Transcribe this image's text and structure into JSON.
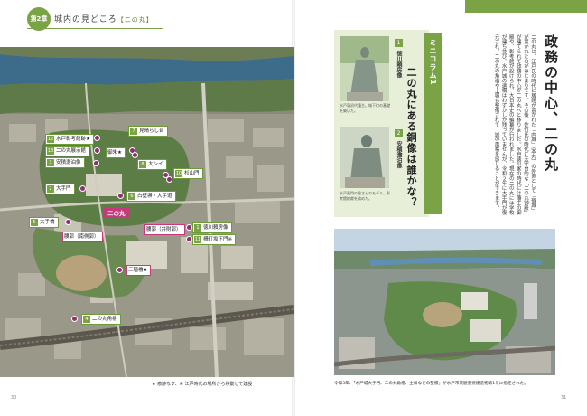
{
  "header": {
    "chapter_badge": "第2章",
    "title": "城内の見どころ",
    "subtitle": "【二の丸】"
  },
  "map": {
    "center_label": "二の丸",
    "labels": [
      {
        "num": "12",
        "text": "水戸彰考館跡★",
        "color": "green"
      },
      {
        "num": "13",
        "text": "二の丸展示館",
        "color": "green"
      },
      {
        "num": "3",
        "text": "安積澹泊像",
        "color": "green"
      },
      {
        "num": "2",
        "text": "大手門",
        "color": "green"
      },
      {
        "num": "5",
        "text": "大手橋",
        "color": "green"
      },
      {
        "num": "7",
        "text": "見晴らし台",
        "color": "green"
      },
      {
        "num": "8",
        "text": "大シイ",
        "color": "green"
      },
      {
        "num": "10",
        "text": "杉山門",
        "color": "green"
      },
      {
        "num": "",
        "text": "御朱★",
        "color": "green"
      },
      {
        "num": "6",
        "text": "白壁塀・大手道",
        "color": "green"
      },
      {
        "num": "",
        "text": "腰郭（南側郭）",
        "color": "pink"
      },
      {
        "num": "",
        "text": "腰郭（弁財郭）",
        "color": "pink"
      },
      {
        "num": "1",
        "text": "徳川頼房像",
        "color": "green"
      },
      {
        "num": "11",
        "text": "柵町坂下門※",
        "color": "green"
      },
      {
        "num": "",
        "text": "三階櫓★",
        "color": "pink"
      },
      {
        "num": "4",
        "text": "二の丸角櫓",
        "color": "green"
      }
    ],
    "caption": "★ 痕跡なす、※ 江戸時代の場所から移動して建設"
  },
  "column": {
    "tag": "ミニコラム1",
    "title": "二の丸にある銅像は誰かな？",
    "statues": [
      {
        "num": "1",
        "name": "徳川頼房像",
        "caption": "水戸藩初代藩主。城下町の基礎を築いた。"
      },
      {
        "num": "2",
        "name": "安積澹泊像",
        "caption": "水戸黄門の格さんのモデル。彰考館総裁を務めた。"
      }
    ]
  },
  "main": {
    "title": "政務の中心、二の丸",
    "body": "二の丸は、江戸氏の時代に居館が置かれた「内城」（本丸）の外側として「宿城」が置かれたのがはじまりです。その後、佐竹氏の時代に天守台的な「二の丸御殿」が建てられて政務の中心が二の丸へと移りました。水戸徳川家の時代には藩主の御殿や、彰考館が設けられ、大日本史の編纂が行われました。現在の二の丸には学校が建ち並び、水戸城の遺構はわずかしか残っていませんが、令和２年に大手門が復元され、二の丸の角櫓や土塀も整備されて、城の風格を感じることができます。"
  },
  "aerial_caption": "令和3年、「水戸城大手門、二の丸角櫓、土塀などの整備」が水戸市景観重要建造物第1号に指定された。",
  "pages": {
    "left": "30",
    "right": "31"
  },
  "colors": {
    "accent": "#7aa346",
    "pink": "#c8387c",
    "panel": "#e7efd9"
  }
}
